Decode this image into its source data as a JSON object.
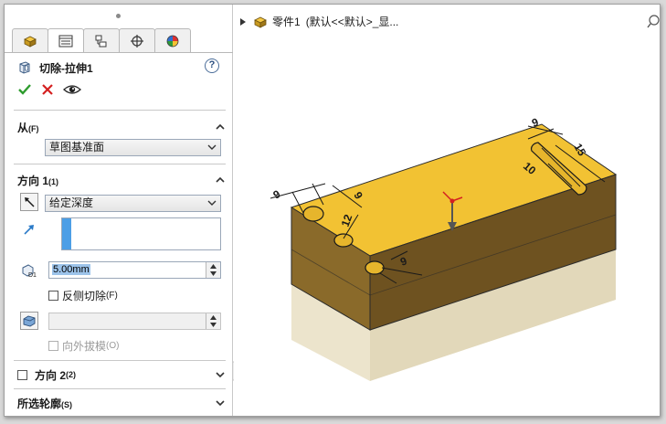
{
  "panel": {
    "tabs": [
      {
        "icon": "feature-manager-icon"
      },
      {
        "icon": "property-manager-icon"
      },
      {
        "icon": "configuration-manager-icon"
      },
      {
        "icon": "dimxpert-icon"
      },
      {
        "icon": "display-manager-icon"
      }
    ],
    "title": "切除-拉伸1",
    "help": "?",
    "from": {
      "header": "从",
      "header_key": "(F)",
      "value": "草图基准面"
    },
    "direction1": {
      "header": "方向 1",
      "header_key": "(1)",
      "end_condition": "给定深度",
      "depth": "5.00mm",
      "flip_side_label": "反侧切除",
      "flip_side_key": "(F)",
      "draft_outward_label": "向外拔模",
      "draft_outward_key": "(O)"
    },
    "direction2": {
      "header": "方向 2",
      "header_key": "(2)"
    },
    "selected_contours": {
      "header": "所选轮廓",
      "header_key": "(S)"
    }
  },
  "viewport": {
    "breadcrumb_part": "零件1",
    "breadcrumb_config": "(默认<<默认>_显...",
    "dimensions": [
      "9",
      "9",
      "12",
      "9",
      "9",
      "15",
      "10"
    ],
    "diameter_symbol": "⌀"
  },
  "colors": {
    "accent": "#4c9ee6",
    "part_top": "#f2c233",
    "part_side_front": "#8a6a2a",
    "part_side_right": "#6e5220",
    "base_body": "#eee8d4",
    "ok": "#2e9c2e",
    "cancel": "#d42020"
  }
}
